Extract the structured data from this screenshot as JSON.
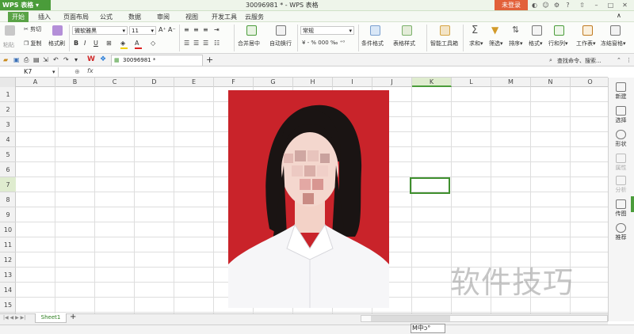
{
  "titlebar": {
    "app_menu": "WPS 表格",
    "doc_title": "30096981 * - WPS 表格",
    "login_label": "未登录"
  },
  "menu": {
    "tabs": [
      "开始",
      "插入",
      "页面布局",
      "公式",
      "数据",
      "审阅",
      "视图",
      "开发工具",
      "云服务"
    ],
    "active_tab": "开始"
  },
  "ribbon": {
    "paste": "粘贴",
    "cut": "剪切",
    "copy": "复制",
    "format_painter": "格式刷",
    "font_name": "微软雅黑",
    "font_size": "11",
    "number_format": "常规",
    "merge_center": "合并居中",
    "wrap_text": "自动换行",
    "conditional_format": "条件格式",
    "table_style": "表格样式",
    "smart_toolbox": "智能工具箱",
    "sum": "求和",
    "filter": "筛选",
    "sort": "排序",
    "format": "格式",
    "row_col": "行和列",
    "worksheet": "工作表",
    "freeze": "冻结窗格"
  },
  "doc_tab": {
    "name": "30096981 *"
  },
  "search": {
    "placeholder": "查找命令、搜索..."
  },
  "formula_bar": {
    "name_box": "K7",
    "fx": "fx"
  },
  "grid": {
    "columns": [
      "A",
      "B",
      "C",
      "D",
      "E",
      "F",
      "G",
      "H",
      "I",
      "J",
      "K",
      "L",
      "M",
      "N",
      "O"
    ],
    "rows": [
      "1",
      "2",
      "3",
      "4",
      "5",
      "6",
      "7",
      "8",
      "9",
      "10",
      "11",
      "12",
      "13",
      "14",
      "15"
    ],
    "selected_col": "K",
    "selected_row": "7"
  },
  "sidebar": {
    "items": [
      "新建",
      "选择",
      "形状",
      "属性",
      "分析",
      "传图",
      "推荐"
    ]
  },
  "sheet": {
    "name": "Sheet1",
    "add": "+"
  },
  "status": {
    "ime": "M中ↄ°"
  },
  "watermark": "软件技巧",
  "colors": {
    "accent": "#4a9c3a",
    "photo_bg": "#c9232a",
    "login": "#e2603a"
  }
}
